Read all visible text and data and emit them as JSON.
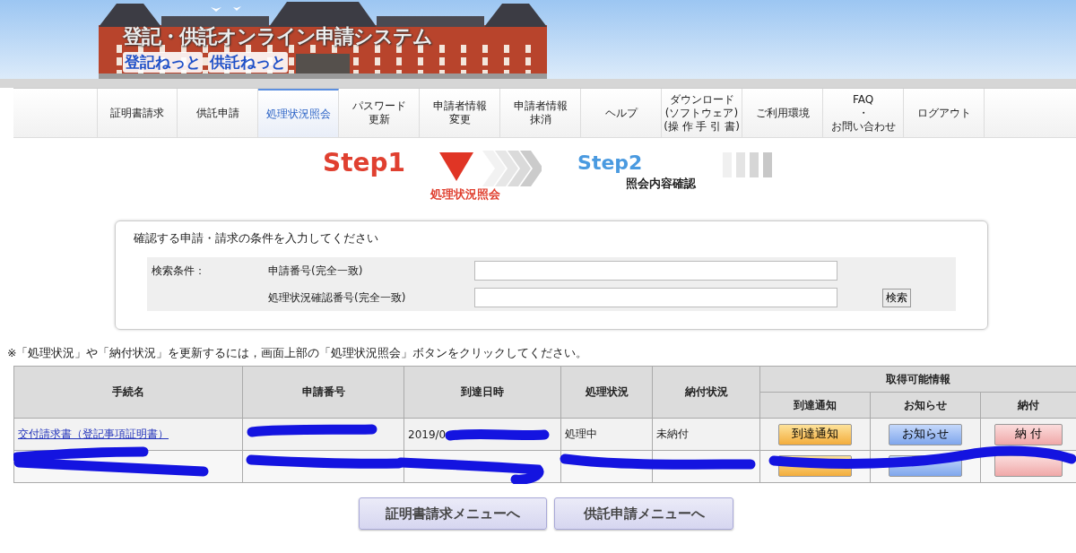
{
  "banner": {
    "title": "登記・供託オンライン申請システム",
    "subtitles": [
      "登記ねっと",
      "供託ねっと"
    ]
  },
  "nav": [
    {
      "label": "証明書請求",
      "selected": false
    },
    {
      "label": "供託申請",
      "selected": false
    },
    {
      "label": "処理状況照会",
      "selected": true
    },
    {
      "lines": [
        "パスワード",
        "更新"
      ],
      "selected": false
    },
    {
      "lines": [
        "申請者情報",
        "変更"
      ],
      "selected": false
    },
    {
      "lines": [
        "申請者情報",
        "抹消"
      ],
      "selected": false
    },
    {
      "label": "ヘルプ",
      "selected": false
    },
    {
      "lines": [
        "ダウンロード",
        "(ソフトウェア)",
        "(操 作 手 引 書)"
      ],
      "selected": false
    },
    {
      "label": "ご利用環境",
      "selected": false
    },
    {
      "lines": [
        "FAQ",
        "・",
        "お問い合わせ"
      ],
      "selected": false
    },
    {
      "label": "ログアウト",
      "selected": false
    }
  ],
  "steps": [
    {
      "step": "Step1",
      "label": "処理状況照会",
      "selected": true
    },
    {
      "step": "Step2",
      "label": "照会内容確認",
      "selected": false
    }
  ],
  "search": {
    "heading": "確認する申請・請求の条件を入力してください",
    "condition_label": "検索条件：",
    "fields": [
      {
        "label": "申請番号(完全一致)"
      },
      {
        "label": "処理状況確認番号(完全一致)"
      }
    ],
    "button": "検索"
  },
  "note": "※「処理状況」や「納付状況」を更新するには，画面上部の「処理状況照会」ボタンをクリックしてください。",
  "table": {
    "columns": [
      "手続名",
      "申請番号",
      "到達日時",
      "処理状況",
      "納付状況"
    ],
    "group_header": "取得可能情報",
    "subcolumns": [
      "到達通知",
      "お知らせ",
      "納付"
    ],
    "rows": [
      {
        "procedure": "交付請求書（登記事項証明書）",
        "arrival": "2019/0",
        "status": "処理中",
        "payment": "未納付",
        "actions": [
          {
            "kind": "arrival",
            "label": "到達通知"
          },
          {
            "kind": "notice",
            "label": "お知らせ"
          },
          {
            "kind": "payment",
            "label": "納 付"
          }
        ]
      },
      {
        "actions": [
          {
            "kind": "arrival"
          },
          {
            "kind": "notice"
          },
          {
            "kind": "payment"
          }
        ]
      }
    ]
  },
  "footer_buttons": [
    "証明書請求メニューへ",
    "供託申請メニューへ"
  ]
}
